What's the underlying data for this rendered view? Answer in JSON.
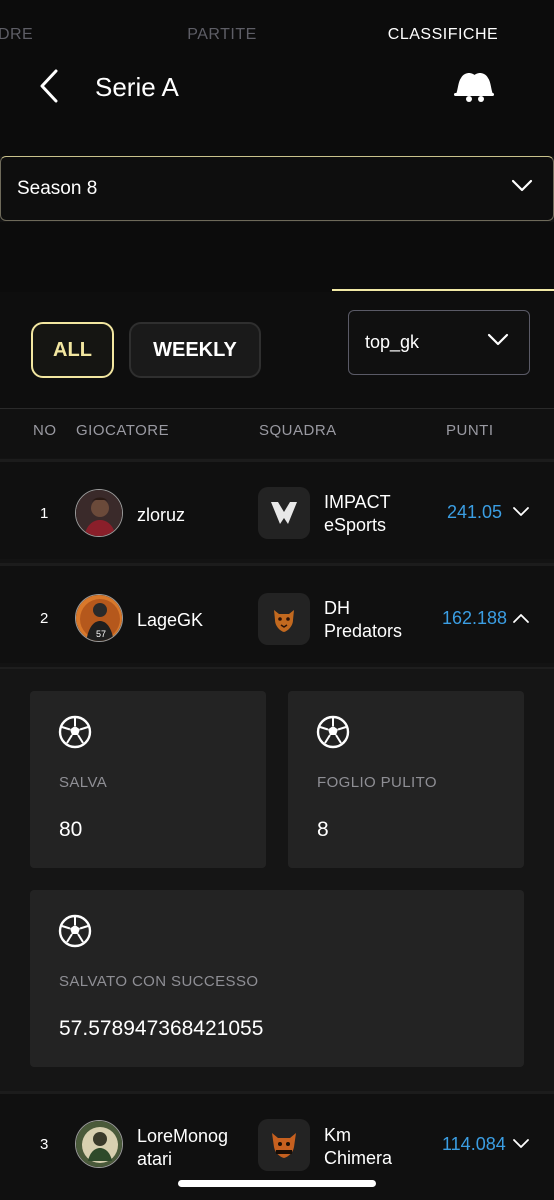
{
  "header": {
    "title": "Serie A"
  },
  "season_select": {
    "value": "Season 8"
  },
  "tabs": [
    {
      "label": "ADRE"
    },
    {
      "label": "PARTITE"
    },
    {
      "label": "CLASSIFICHE",
      "active": true
    }
  ],
  "filters": {
    "all_label": "ALL",
    "weekly_label": "WEEKLY",
    "stat_value": "top_gk"
  },
  "table": {
    "headers": {
      "no": "NO",
      "player": "GIOCATORE",
      "team": "SQUADRA",
      "points": "PUNTI"
    },
    "rows": [
      {
        "no": "1",
        "player": "zloruz",
        "team_line1": "IMPACT",
        "team_line2": "eSports",
        "points": "241.05",
        "expanded": false
      },
      {
        "no": "2",
        "player": "LageGK",
        "team_line1": "DH",
        "team_line2": "Predators",
        "points": "162.188",
        "expanded": true
      },
      {
        "no": "3",
        "player_line1": "LoreMonog",
        "player_line2": "atari",
        "team_line1": "Km",
        "team_line2": "Chimera",
        "points": "114.084",
        "expanded": false
      }
    ]
  },
  "details": {
    "saves_label": "SALVA",
    "saves_value": "80",
    "clean_sheet_label": "FOGLIO PULITO",
    "clean_sheet_value": "8",
    "success_label": "SALVATO CON SUCCESSO",
    "success_value": "57.578947368421055"
  },
  "colors": {
    "accent": "#f2e6a0",
    "points": "#3b9ee3"
  }
}
